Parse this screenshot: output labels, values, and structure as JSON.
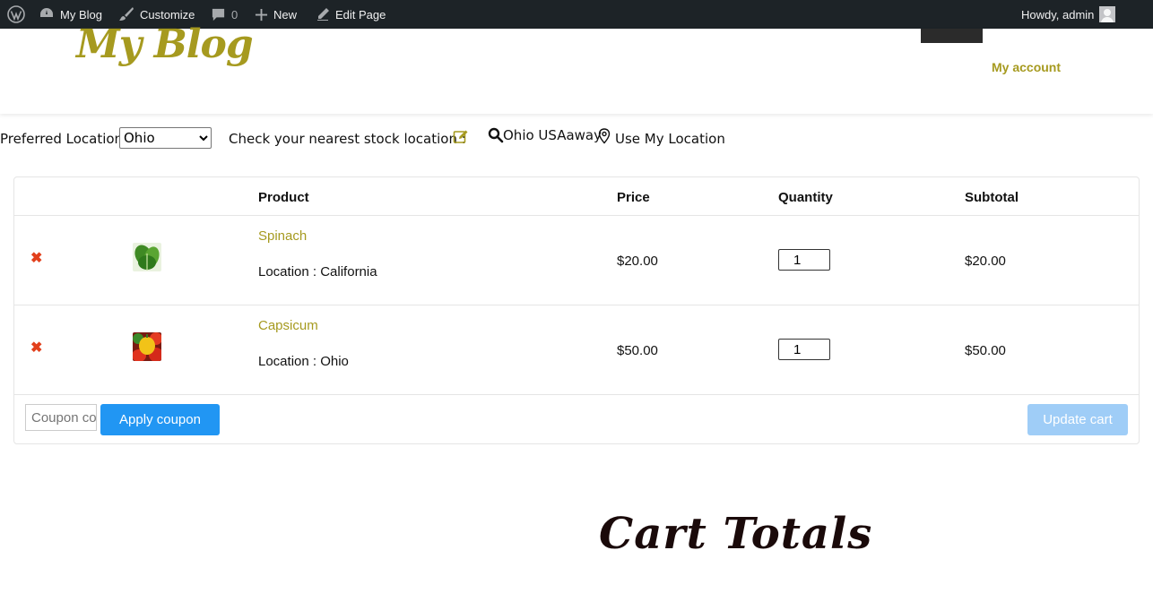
{
  "adminbar": {
    "site_name": "My Blog",
    "customize": "Customize",
    "comments_count": "0",
    "new": "New",
    "edit_page": "Edit Page",
    "howdy": "Howdy, admin"
  },
  "header": {
    "site_title": "My Blog",
    "my_account": "My account"
  },
  "location": {
    "preferred_label": "Preferred Location:",
    "selected": "Ohio",
    "check_label": "Check your nearest stock location :",
    "search_text": "Ohio USAaway",
    "use_my_location": "Use My Location"
  },
  "cart": {
    "columns": {
      "product": "Product",
      "price": "Price",
      "quantity": "Quantity",
      "subtotal": "Subtotal"
    },
    "remove_symbol": "✖",
    "items": [
      {
        "name": "Spinach",
        "location": "Location : California",
        "price": "$20.00",
        "quantity": "1",
        "subtotal": "$20.00"
      },
      {
        "name": "Capsicum",
        "location": "Location : Ohio",
        "price": "$50.00",
        "quantity": "1",
        "subtotal": "$50.00"
      }
    ],
    "coupon_placeholder": "Coupon code",
    "apply_coupon": "Apply coupon",
    "update_cart": "Update cart"
  },
  "totals": {
    "title": "Cart Totals"
  },
  "colors": {
    "accent": "#a69a1f",
    "button": "#2196f3",
    "button_disabled": "#9fcdf7",
    "remove": "#e2401c",
    "adminbar": "#1d2327"
  }
}
